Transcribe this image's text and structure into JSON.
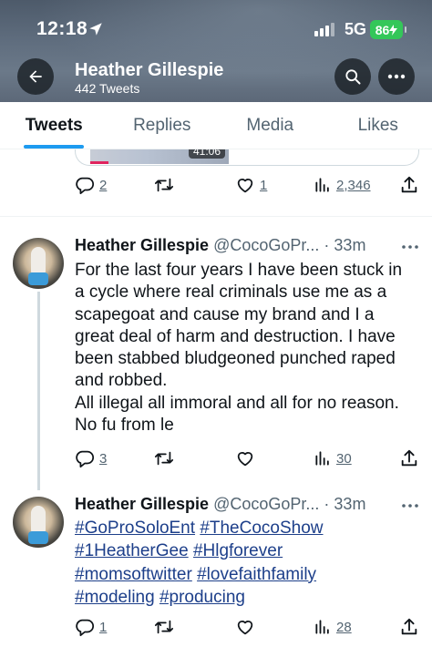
{
  "status_bar": {
    "time": "12:18",
    "network": "5G",
    "battery": "86"
  },
  "header": {
    "profile_name": "Heather Gillespie",
    "tweet_count": "442 Tweets"
  },
  "tabs": [
    {
      "label": "Tweets",
      "active": true
    },
    {
      "label": "Replies",
      "active": false
    },
    {
      "label": "Media",
      "active": false
    },
    {
      "label": "Likes",
      "active": false
    }
  ],
  "prev_tweet": {
    "video_duration": "41:06",
    "replies": "2",
    "likes": "1",
    "views": "2,346"
  },
  "tweets": [
    {
      "name": "Heather Gillespie",
      "handle": "@CocoGoPr...",
      "time": "· 33m",
      "lines": [
        "For the last four years I have been stuck in",
        "a cycle where real criminals use me as a",
        "scapegoat and cause my brand and I a",
        "great deal of harm and destruction. I have",
        "been stabbed bludgeoned punched raped",
        "and robbed.",
        "All illegal all immoral and all for no reason.",
        "No fu from le"
      ],
      "replies": "3",
      "views": "30"
    },
    {
      "name": "Heather Gillespie",
      "handle": "@CocoGoPr...",
      "time": "· 33m",
      "hashtag_lines": [
        [
          "#GoProSoloEnt",
          "#TheCocoShow"
        ],
        [
          "#1HeatherGee",
          "#Hlgforever"
        ],
        [
          "#momsoftwitter",
          "#lovefaithfamily"
        ],
        [
          "#modeling",
          "#producing"
        ]
      ],
      "replies": "1",
      "views": "28"
    }
  ],
  "colors": {
    "accent": "#1d9bf0",
    "text": "#0f1419",
    "secondary": "#536471",
    "hashtag": "#1d3f8a"
  }
}
